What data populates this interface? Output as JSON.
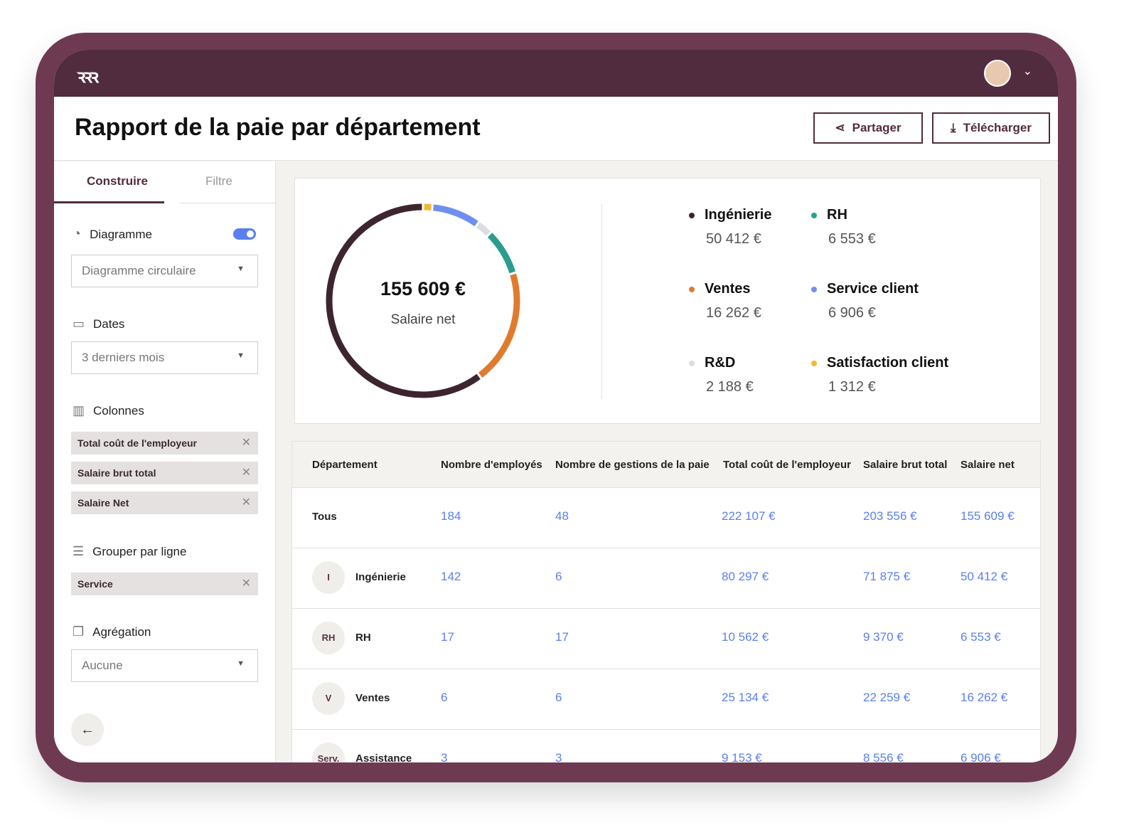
{
  "header": {
    "logo": "ꝛꝛꝛ",
    "title": "Rapport de la paie par département",
    "share": "Partager",
    "download": "Télécharger"
  },
  "sidebar": {
    "tabs": [
      "Construire",
      "Filtre"
    ],
    "chart_label": "Diagramme",
    "chart_toggle": true,
    "chart_type": "Diagramme circulaire",
    "dates_label": "Dates",
    "dates_value": "3 derniers mois",
    "columns_label": "Colonnes",
    "columns": [
      "Total coût de l'employeur",
      "Salaire brut total",
      "Salaire Net"
    ],
    "group_label": "Grouper par ligne",
    "group": [
      "Service"
    ],
    "agg_label": "Agrégation",
    "agg_value": "Aucune"
  },
  "chart_data": {
    "type": "pie",
    "donut": true,
    "center_value": "155 609 €",
    "center_label": "Salaire net",
    "series": [
      {
        "name": "Ingénierie",
        "value": 50412,
        "label": "50 412 €",
        "color": "#3d2530"
      },
      {
        "name": "RH",
        "value": 6553,
        "label": "6 553 €",
        "color": "#2a9d8f"
      },
      {
        "name": "Ventes",
        "value": 16262,
        "label": "16 262 €",
        "color": "#e07b2e"
      },
      {
        "name": "Service client",
        "value": 6906,
        "label": "6 906 €",
        "color": "#6f8ff0"
      },
      {
        "name": "R&D",
        "value": 2188,
        "label": "2 188 €",
        "color": "#dcdce4"
      },
      {
        "name": "Satisfaction client",
        "value": 1312,
        "label": "1 312 €",
        "color": "#f6b731"
      }
    ]
  },
  "table": {
    "headers": [
      "Département",
      "Nombre d'employés",
      "Nombre de gestions de la paie",
      "Total coût de l'employeur",
      "Salaire brut total",
      "Salaire net"
    ],
    "rows": [
      {
        "initials": "",
        "name": "Tous",
        "c": [
          "184",
          "48",
          "222 107 €",
          "203 556 €",
          "155 609 €"
        ]
      },
      {
        "initials": "I",
        "name": "Ingénierie",
        "c": [
          "142",
          "6",
          "80 297 €",
          "71 875 €",
          "50 412 €"
        ]
      },
      {
        "initials": "RH",
        "name": "RH",
        "c": [
          "17",
          "17",
          "10 562 €",
          "9 370 €",
          "6 553 €"
        ]
      },
      {
        "initials": "V",
        "name": "Ventes",
        "c": [
          "6",
          "6",
          "25 134 €",
          "22 259 €",
          "16 262 €"
        ]
      },
      {
        "initials": "Serv. Cl.",
        "name": "Assistance",
        "c": [
          "3",
          "3",
          "9 153 €",
          "8 556 €",
          "6 906 €"
        ]
      }
    ]
  }
}
